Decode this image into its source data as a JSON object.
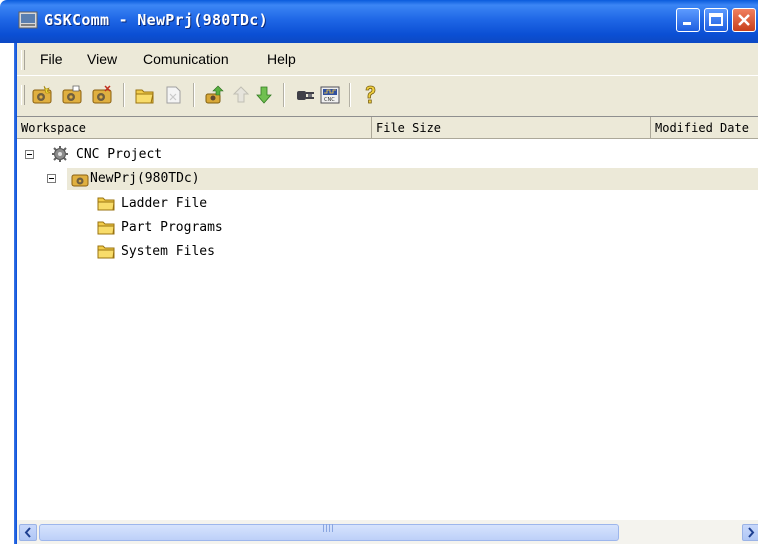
{
  "window": {
    "title": "GSKComm - NewPrj(980TDc)"
  },
  "menu": {
    "items": [
      "File",
      "View",
      "Comunication",
      "Help"
    ]
  },
  "toolbar": {
    "icons": [
      "new-project-icon",
      "open-project-icon",
      "close-project-icon",
      "open-folder-icon",
      "blank-document-icon",
      "upload-icon",
      "upload-disabled-icon",
      "download-icon",
      "connect-icon",
      "cnc-panel-icon",
      "help-icon"
    ]
  },
  "list": {
    "columns": [
      "Workspace",
      "File Size",
      "Modified Date"
    ],
    "tree": {
      "root": "CNC Project",
      "project": "NewPrj(980TDc)",
      "folders": [
        "Ladder File",
        "Part Programs",
        "System Files"
      ]
    }
  },
  "colors": {
    "titlebar": "#0b4fd4",
    "chrome": "#ece9d8",
    "selection": "#ece9d8",
    "close_button": "#c8401c"
  }
}
